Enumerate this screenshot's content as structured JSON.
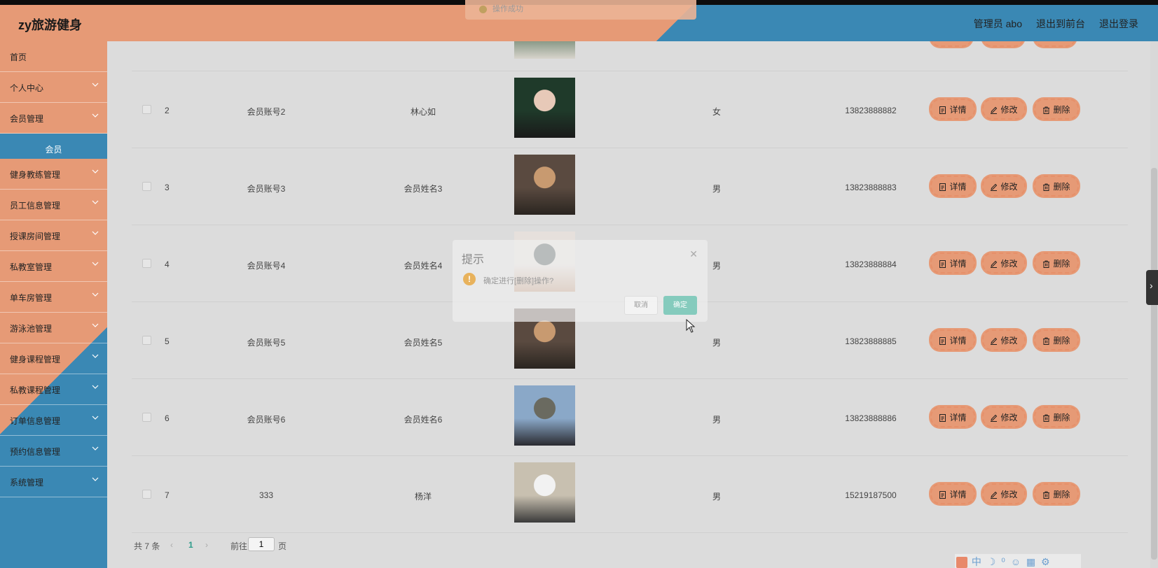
{
  "header": {
    "brand": "zy旅游健身",
    "admin_label": "管理员 abo",
    "to_front_label": "退出到前台",
    "logout_label": "退出登录"
  },
  "toast": {
    "text": "操作成功"
  },
  "sidebar": {
    "items": [
      {
        "label": "首页",
        "has_chevron": false
      },
      {
        "label": "个人中心",
        "has_chevron": true
      },
      {
        "label": "会员管理",
        "has_chevron": true
      },
      {
        "label": "会员",
        "has_chevron": false,
        "active": true
      },
      {
        "label": "健身教练管理",
        "has_chevron": true
      },
      {
        "label": "员工信息管理",
        "has_chevron": true
      },
      {
        "label": "授课房间管理",
        "has_chevron": true
      },
      {
        "label": "私教室管理",
        "has_chevron": true
      },
      {
        "label": "单车房管理",
        "has_chevron": true
      },
      {
        "label": "游泳池管理",
        "has_chevron": true
      },
      {
        "label": "健身课程管理",
        "has_chevron": true
      },
      {
        "label": "私教课程管理",
        "has_chevron": true
      },
      {
        "label": "订单信息管理",
        "has_chevron": true
      },
      {
        "label": "预约信息管理",
        "has_chevron": true
      },
      {
        "label": "系统管理",
        "has_chevron": true
      }
    ]
  },
  "table": {
    "actions": {
      "detail": "详情",
      "edit": "修改",
      "delete": "删除"
    },
    "rows": [
      {
        "index": "2",
        "account": "会员账号2",
        "name": "林心如",
        "gender": "女",
        "phone": "13823888882",
        "photo_palette": [
          "#1f3a2a",
          "#e7c9b8",
          "#1a1a1a"
        ]
      },
      {
        "index": "3",
        "account": "会员账号3",
        "name": "会员姓名3",
        "gender": "男",
        "phone": "13823888883",
        "photo_palette": [
          "#5a4a40",
          "#c89a70",
          "#2a2520"
        ]
      },
      {
        "index": "4",
        "account": "会员账号4",
        "name": "会员姓名4",
        "gender": "男",
        "phone": "13823888884",
        "photo_palette": [
          "#e6e0dc",
          "#2c3a3a",
          "#b98a6a"
        ]
      },
      {
        "index": "5",
        "account": "会员账号5",
        "name": "会员姓名5",
        "gender": "男",
        "phone": "13823888885",
        "photo_palette": [
          "#5a4a40",
          "#c89a70",
          "#2a2520"
        ]
      },
      {
        "index": "6",
        "account": "会员账号6",
        "name": "会员姓名6",
        "gender": "男",
        "phone": "13823888886",
        "photo_palette": [
          "#8aa8c8",
          "#6a6a60",
          "#2a2a30"
        ]
      },
      {
        "index": "7",
        "account": "333",
        "name": "杨洋",
        "gender": "男",
        "phone": "15219187500",
        "photo_palette": [
          "#c8c0b0",
          "#f2f2f2",
          "#3a3a3a"
        ]
      }
    ]
  },
  "pagination": {
    "total": "共 7 条",
    "current_page": "1",
    "goto_label": "前往",
    "goto_value": "1",
    "page_suffix": "页"
  },
  "dialog": {
    "title": "提示",
    "message": "确定进行[删除]操作?",
    "cancel_label": "取消",
    "confirm_label": "确定"
  },
  "ime": {
    "mode": "中"
  },
  "colors": {
    "accent_orange": "#e69a76",
    "accent_blue": "#3a88b4",
    "confirm_green": "#85cbbd"
  }
}
